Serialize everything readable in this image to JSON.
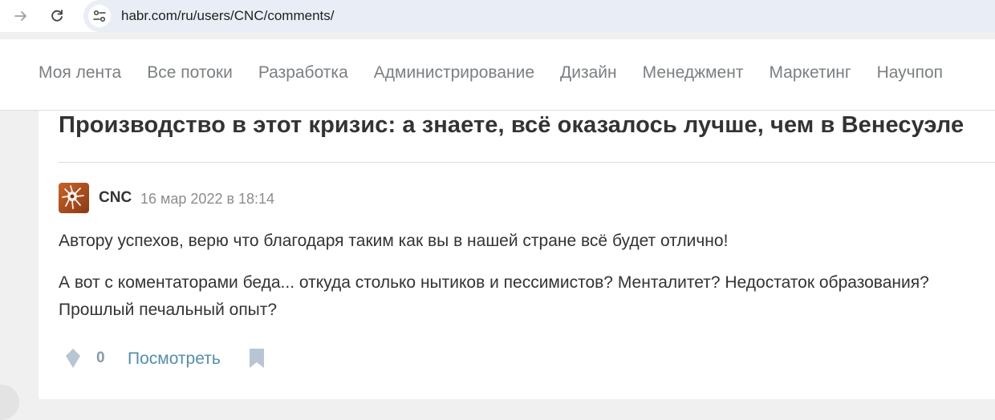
{
  "browser": {
    "url": "habr.com/ru/users/CNC/comments/"
  },
  "header": {
    "flows": [
      "Моя лента",
      "Все потоки",
      "Разработка",
      "Администрирование",
      "Дизайн",
      "Менеджмент",
      "Маркетинг",
      "Научпоп"
    ]
  },
  "article": {
    "title": "Производство в этот кризис: а знаете, всё оказалось лучше, чем в Венесуэле"
  },
  "comment": {
    "author": "CNC",
    "date": "16 мар 2022 в 18:14",
    "paragraphs": [
      "Автору успехов, верю что благодаря таким как вы в нашей стране всё будет отлично!",
      "А вот с коментаторами беда... откуда столько нытиков и пессимистов? Менталитет? Недостаток образования? Прошлый печальный опыт?"
    ],
    "score": "0",
    "view_label": "Посмотреть"
  },
  "icons": {
    "forward": "arrow-right-icon",
    "reload": "reload-icon",
    "site_info": "tune-icon",
    "vote": "diamond-vote-icon",
    "bookmark": "bookmark-icon"
  },
  "colors": {
    "link": "#548eaa",
    "flow_text": "#7b7f82",
    "omnibox": "#e9eef6",
    "icon_muted": "#b7c6d2"
  }
}
